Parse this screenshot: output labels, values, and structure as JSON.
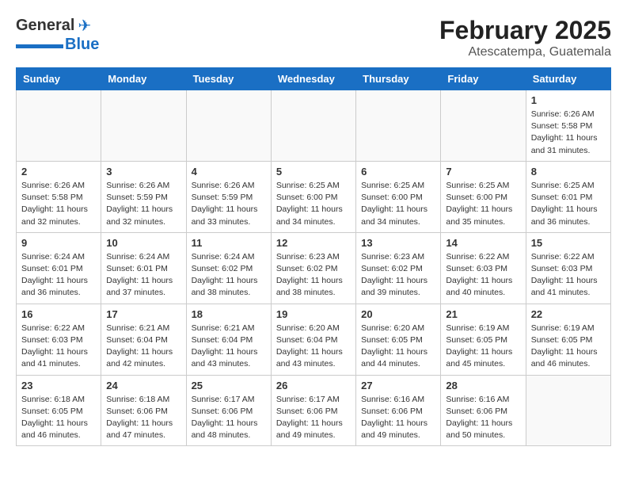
{
  "header": {
    "logo_general": "General",
    "logo_blue": "Blue",
    "month_year": "February 2025",
    "location": "Atescatempa, Guatemala"
  },
  "days_of_week": [
    "Sunday",
    "Monday",
    "Tuesday",
    "Wednesday",
    "Thursday",
    "Friday",
    "Saturday"
  ],
  "weeks": [
    {
      "days": [
        {
          "num": "",
          "info": ""
        },
        {
          "num": "",
          "info": ""
        },
        {
          "num": "",
          "info": ""
        },
        {
          "num": "",
          "info": ""
        },
        {
          "num": "",
          "info": ""
        },
        {
          "num": "",
          "info": ""
        },
        {
          "num": "1",
          "info": "Sunrise: 6:26 AM\nSunset: 5:58 PM\nDaylight: 11 hours and 31 minutes."
        }
      ]
    },
    {
      "days": [
        {
          "num": "2",
          "info": "Sunrise: 6:26 AM\nSunset: 5:58 PM\nDaylight: 11 hours and 32 minutes."
        },
        {
          "num": "3",
          "info": "Sunrise: 6:26 AM\nSunset: 5:59 PM\nDaylight: 11 hours and 32 minutes."
        },
        {
          "num": "4",
          "info": "Sunrise: 6:26 AM\nSunset: 5:59 PM\nDaylight: 11 hours and 33 minutes."
        },
        {
          "num": "5",
          "info": "Sunrise: 6:25 AM\nSunset: 6:00 PM\nDaylight: 11 hours and 34 minutes."
        },
        {
          "num": "6",
          "info": "Sunrise: 6:25 AM\nSunset: 6:00 PM\nDaylight: 11 hours and 34 minutes."
        },
        {
          "num": "7",
          "info": "Sunrise: 6:25 AM\nSunset: 6:00 PM\nDaylight: 11 hours and 35 minutes."
        },
        {
          "num": "8",
          "info": "Sunrise: 6:25 AM\nSunset: 6:01 PM\nDaylight: 11 hours and 36 minutes."
        }
      ]
    },
    {
      "days": [
        {
          "num": "9",
          "info": "Sunrise: 6:24 AM\nSunset: 6:01 PM\nDaylight: 11 hours and 36 minutes."
        },
        {
          "num": "10",
          "info": "Sunrise: 6:24 AM\nSunset: 6:01 PM\nDaylight: 11 hours and 37 minutes."
        },
        {
          "num": "11",
          "info": "Sunrise: 6:24 AM\nSunset: 6:02 PM\nDaylight: 11 hours and 38 minutes."
        },
        {
          "num": "12",
          "info": "Sunrise: 6:23 AM\nSunset: 6:02 PM\nDaylight: 11 hours and 38 minutes."
        },
        {
          "num": "13",
          "info": "Sunrise: 6:23 AM\nSunset: 6:02 PM\nDaylight: 11 hours and 39 minutes."
        },
        {
          "num": "14",
          "info": "Sunrise: 6:22 AM\nSunset: 6:03 PM\nDaylight: 11 hours and 40 minutes."
        },
        {
          "num": "15",
          "info": "Sunrise: 6:22 AM\nSunset: 6:03 PM\nDaylight: 11 hours and 41 minutes."
        }
      ]
    },
    {
      "days": [
        {
          "num": "16",
          "info": "Sunrise: 6:22 AM\nSunset: 6:03 PM\nDaylight: 11 hours and 41 minutes."
        },
        {
          "num": "17",
          "info": "Sunrise: 6:21 AM\nSunset: 6:04 PM\nDaylight: 11 hours and 42 minutes."
        },
        {
          "num": "18",
          "info": "Sunrise: 6:21 AM\nSunset: 6:04 PM\nDaylight: 11 hours and 43 minutes."
        },
        {
          "num": "19",
          "info": "Sunrise: 6:20 AM\nSunset: 6:04 PM\nDaylight: 11 hours and 43 minutes."
        },
        {
          "num": "20",
          "info": "Sunrise: 6:20 AM\nSunset: 6:05 PM\nDaylight: 11 hours and 44 minutes."
        },
        {
          "num": "21",
          "info": "Sunrise: 6:19 AM\nSunset: 6:05 PM\nDaylight: 11 hours and 45 minutes."
        },
        {
          "num": "22",
          "info": "Sunrise: 6:19 AM\nSunset: 6:05 PM\nDaylight: 11 hours and 46 minutes."
        }
      ]
    },
    {
      "days": [
        {
          "num": "23",
          "info": "Sunrise: 6:18 AM\nSunset: 6:05 PM\nDaylight: 11 hours and 46 minutes."
        },
        {
          "num": "24",
          "info": "Sunrise: 6:18 AM\nSunset: 6:06 PM\nDaylight: 11 hours and 47 minutes."
        },
        {
          "num": "25",
          "info": "Sunrise: 6:17 AM\nSunset: 6:06 PM\nDaylight: 11 hours and 48 minutes."
        },
        {
          "num": "26",
          "info": "Sunrise: 6:17 AM\nSunset: 6:06 PM\nDaylight: 11 hours and 49 minutes."
        },
        {
          "num": "27",
          "info": "Sunrise: 6:16 AM\nSunset: 6:06 PM\nDaylight: 11 hours and 49 minutes."
        },
        {
          "num": "28",
          "info": "Sunrise: 6:16 AM\nSunset: 6:06 PM\nDaylight: 11 hours and 50 minutes."
        },
        {
          "num": "",
          "info": ""
        }
      ]
    }
  ]
}
